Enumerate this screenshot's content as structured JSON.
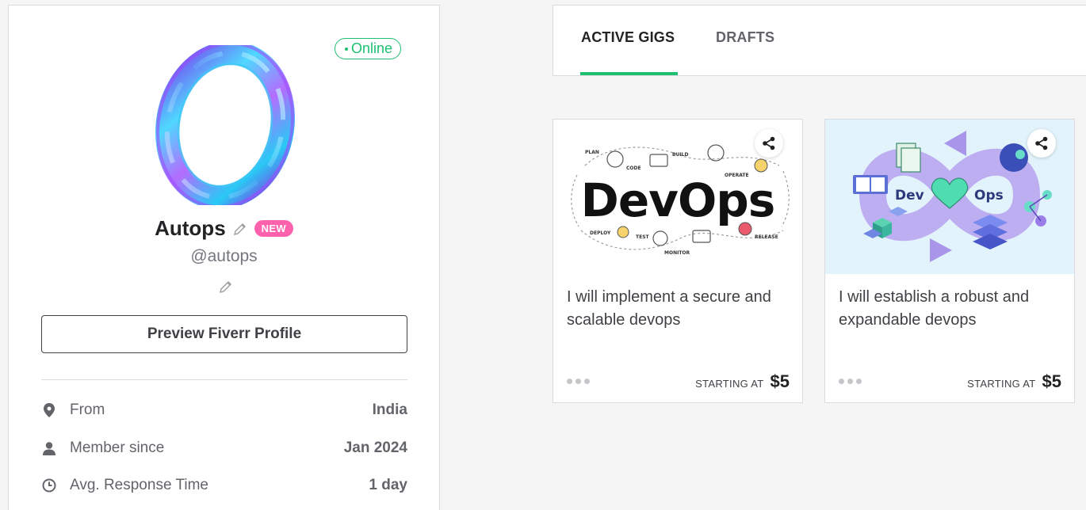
{
  "profile": {
    "status": "Online",
    "name": "Autops",
    "badge": "NEW",
    "username": "@autops",
    "preview_button": "Preview Fiverr Profile",
    "info": [
      {
        "icon": "location-pin-icon",
        "label": "From",
        "value": "India"
      },
      {
        "icon": "user-icon",
        "label": "Member since",
        "value": "Jan 2024"
      },
      {
        "icon": "clock-icon",
        "label": "Avg. Response Time",
        "value": "1 day"
      }
    ]
  },
  "tabs": [
    {
      "label": "ACTIVE GIGS",
      "active": true
    },
    {
      "label": "DRAFTS",
      "active": false
    }
  ],
  "gigs": [
    {
      "image_text": "DevOps",
      "image_labels": [
        "PLAN",
        "CODE",
        "BUILD",
        "OPERATE",
        "DEPLOY",
        "TEST",
        "MONITOR",
        "RELEASE"
      ],
      "title": "I will implement a secure and scalable devops",
      "starting_label": "STARTING AT",
      "price": "$5"
    },
    {
      "image_text_left": "Dev",
      "image_text_right": "Ops",
      "title": "I will establish a robust and expandable devops",
      "starting_label": "STARTING AT",
      "price": "$5"
    }
  ],
  "colors": {
    "accent_green": "#1dbf73",
    "new_badge_pink": "#ff62ad",
    "text_dark": "#222325",
    "text_gray": "#62646a"
  }
}
